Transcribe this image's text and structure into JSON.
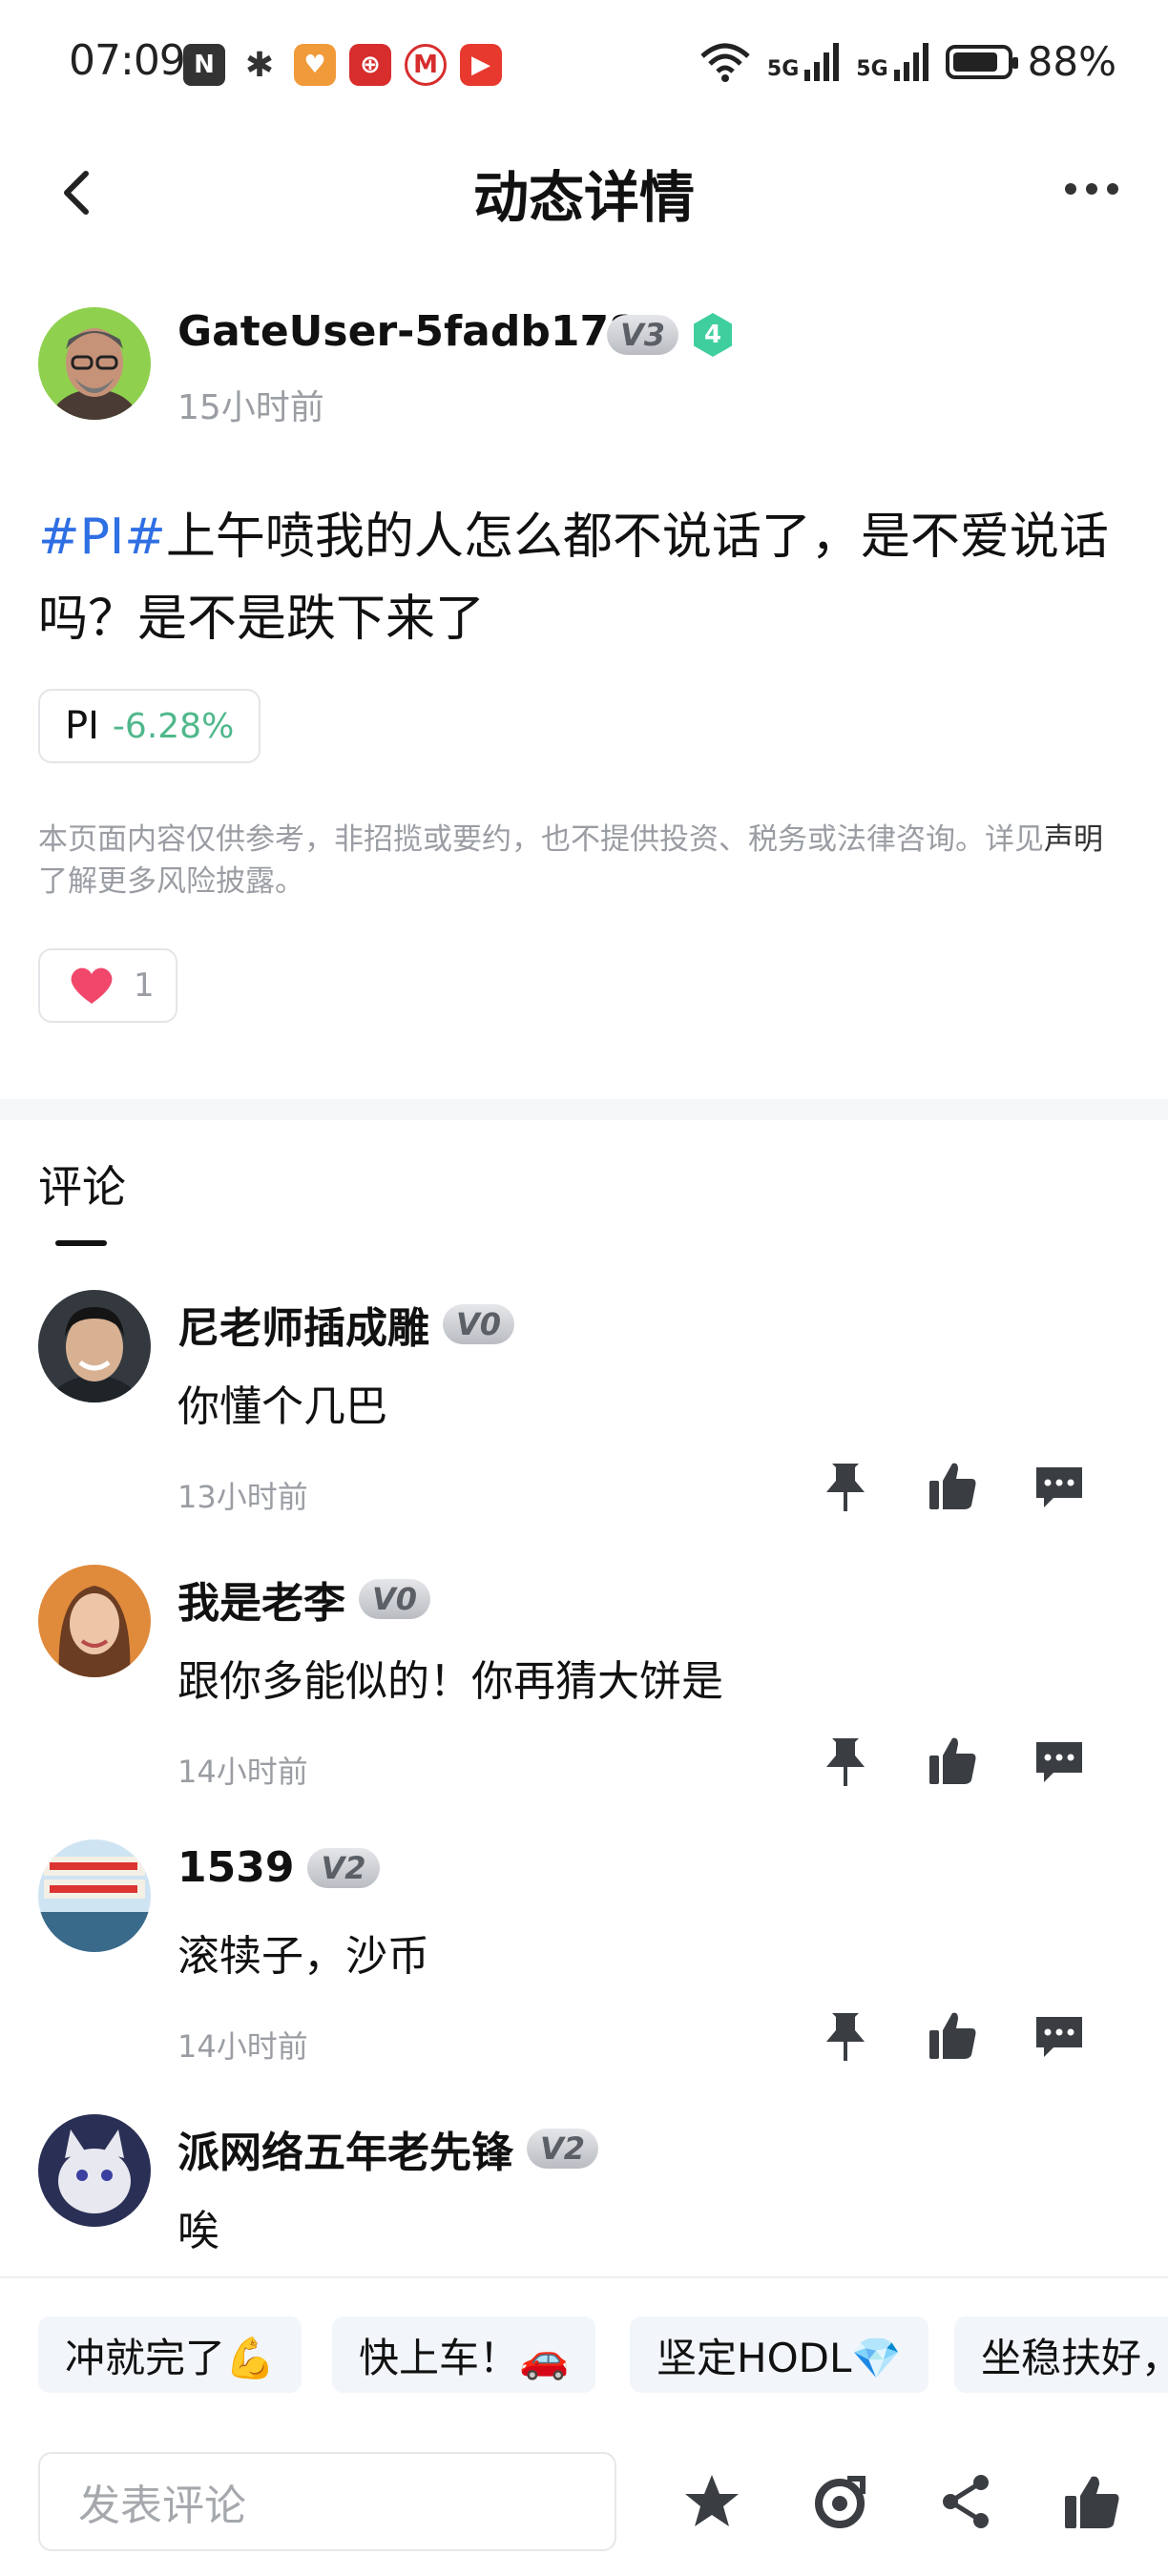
{
  "status_bar": {
    "time": "07:09",
    "network_1": "5G",
    "network_2": "5G",
    "battery": "88%",
    "battery_level": 0.88
  },
  "nav": {
    "title": "动态详情"
  },
  "post": {
    "author": "GateUser-5fadb178",
    "level_badge": "V3",
    "rank_badge": "4",
    "time": "15小时前",
    "tag": "#PI#",
    "text": "上午喷我的人怎么都不说话了，是不爱说话吗？是不是跌下来了",
    "ticker": {
      "symbol": "PI",
      "change": "-6.28%"
    },
    "disclaimer_pre": "本页面内容仅供参考，非招揽或要约，也不提供投资、税务或法律咨询。详见",
    "disclaimer_link": "声明",
    "disclaimer_post": "了解更多风险披露。",
    "like_count": "1"
  },
  "comments_section": {
    "title": "评论",
    "items": [
      {
        "name": "尼老师插成雕",
        "badge": "V0",
        "text": "你懂个几巴",
        "time": "13小时前"
      },
      {
        "name": "我是老李",
        "badge": "V0",
        "text": "跟你多能似的！你再猜大饼是",
        "time": "14小时前"
      },
      {
        "name": "1539",
        "badge": "V2",
        "text": "滚犊子，沙币",
        "time": "14小时前"
      },
      {
        "name": "派网络五年老先锋",
        "badge": "V2",
        "text": "唉",
        "time": ""
      }
    ]
  },
  "quick_replies": [
    "冲就完了💪",
    "快上车！🚗",
    "坚定HODL💎",
    "坐稳扶好，"
  ],
  "bottom_bar": {
    "input_placeholder": "发表评论"
  },
  "colors": {
    "tag_blue": "#2f6fe4",
    "down_green": "#4fb88b",
    "heart_red": "#f0476b",
    "rank_teal": "#3fcf9e"
  }
}
